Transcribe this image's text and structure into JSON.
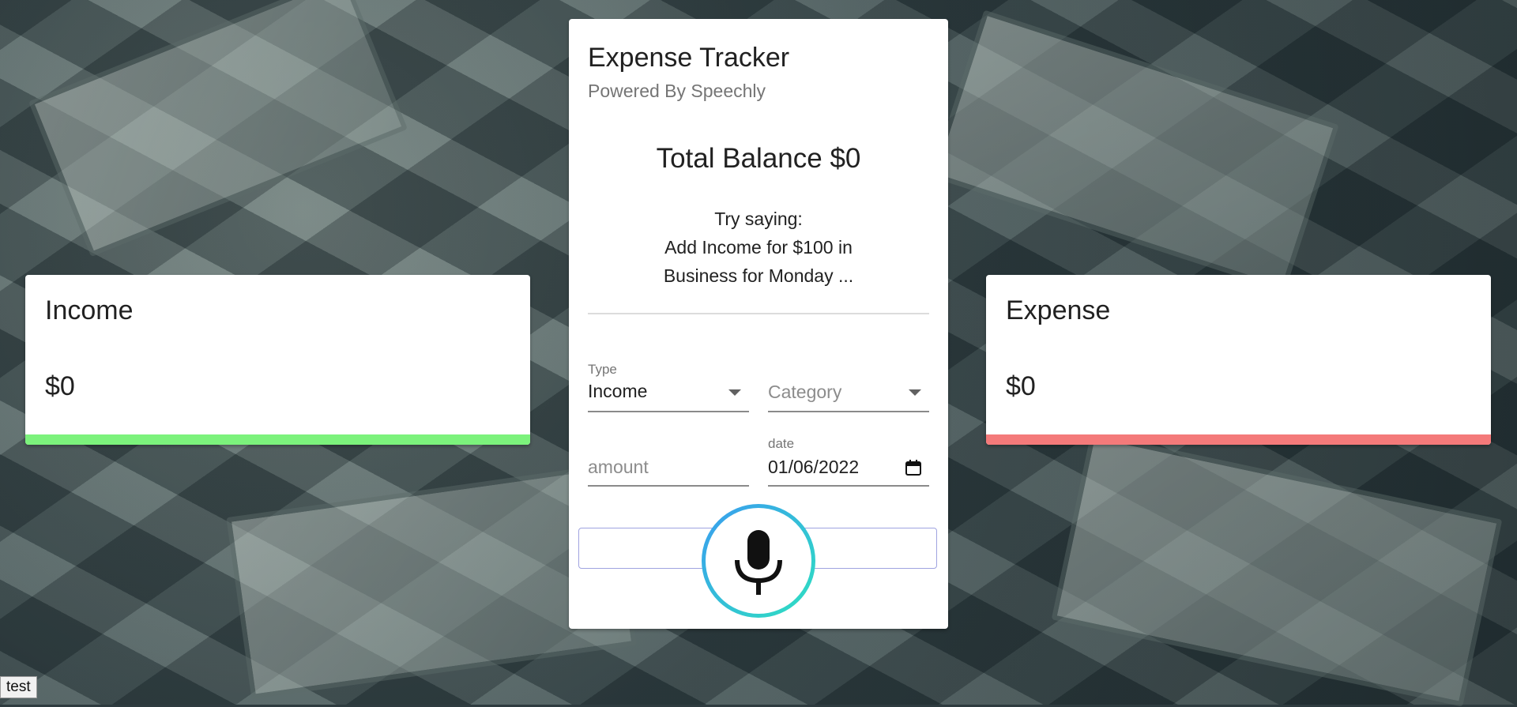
{
  "income": {
    "title": "Income",
    "amount": "$0",
    "bar_color": "#7cf27c"
  },
  "expense": {
    "title": "Expense",
    "amount": "$0",
    "bar_color": "#f47a7a"
  },
  "main": {
    "title": "Expense Tracker",
    "subtitle": "Powered By Speechly",
    "balance": "Total Balance $0",
    "hint_line1": "Try saying:",
    "hint_line2": "Add Income for $100 in",
    "hint_line3": "Business for Monday ..."
  },
  "form": {
    "type_label": "Type",
    "type_value": "Income",
    "category_placeholder": "Category",
    "amount_placeholder": "amount",
    "date_label": "date",
    "date_value": "01/06/2022"
  },
  "icons": {
    "mic": "microphone-icon",
    "calendar": "calendar-icon",
    "dropdown": "chevron-down-icon"
  },
  "footer": {
    "tag": "test"
  },
  "colors": {
    "mic_gradient_start": "#3a9cf0",
    "mic_gradient_end": "#2ee0c0",
    "create_button_border": "#9fa3e0"
  }
}
